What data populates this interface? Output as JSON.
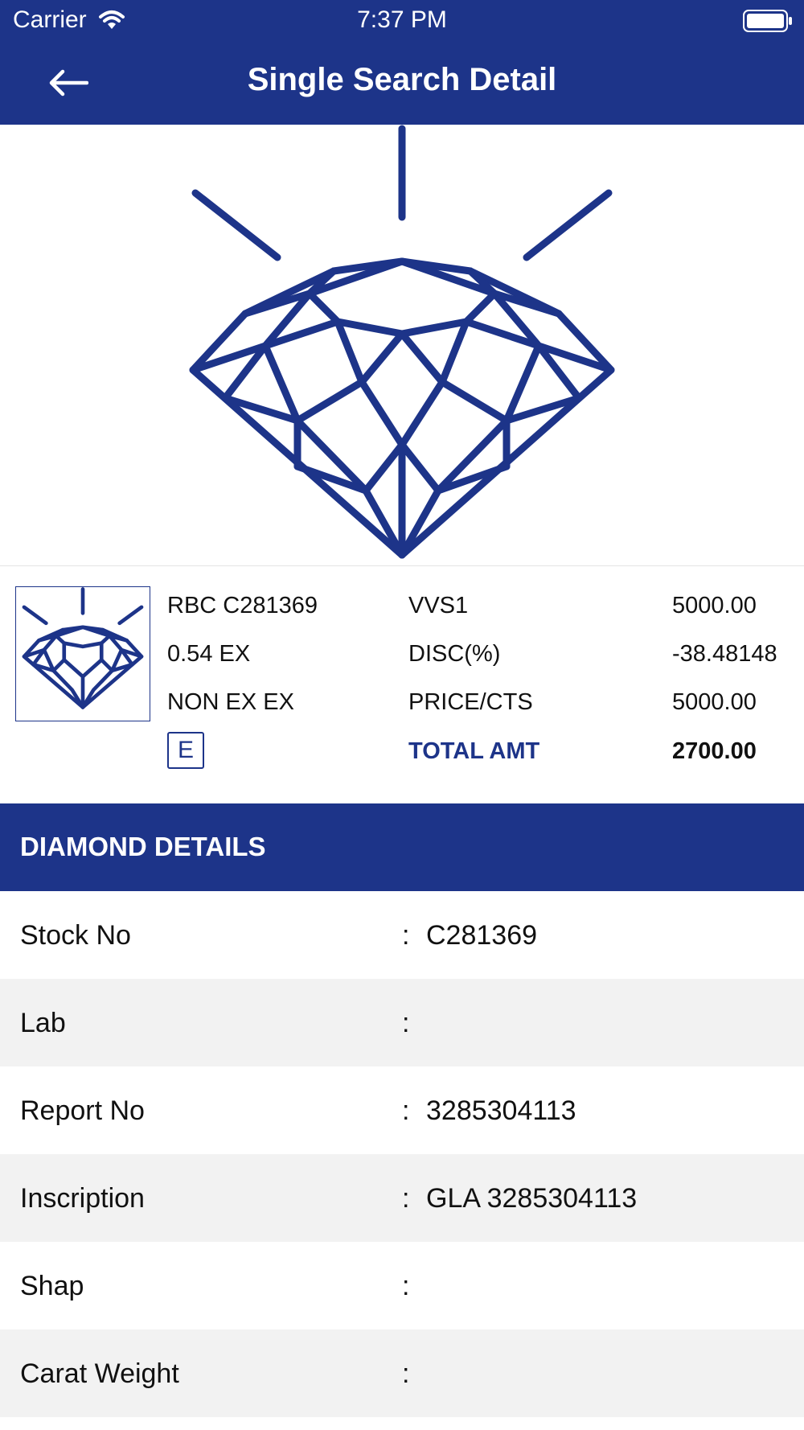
{
  "status_bar": {
    "carrier": "Carrier",
    "time": "7:37 PM"
  },
  "nav": {
    "title": "Single Search Detail"
  },
  "summary": {
    "col1": [
      "RBC C281369",
      "0.54 EX",
      "NON EX EX"
    ],
    "color_badge": "E",
    "col2": [
      "VVS1",
      "DISC(%)",
      "PRICE/CTS"
    ],
    "col3": [
      "5000.00",
      "-38.48148",
      "5000.00"
    ],
    "total_label": "TOTAL AMT",
    "total_value": "2700.00"
  },
  "section": {
    "title": "DIAMOND DETAILS"
  },
  "details": [
    {
      "label": "Stock No",
      "colon": ":",
      "value": "C281369"
    },
    {
      "label": "Lab",
      "colon": ":",
      "value": ""
    },
    {
      "label": "Report No",
      "colon": ":",
      "value": "3285304113"
    },
    {
      "label": "Inscription",
      "colon": ":",
      "value": "GLA 3285304113"
    },
    {
      "label": "Shap",
      "colon": ":",
      "value": ""
    },
    {
      "label": "Carat Weight",
      "colon": ":",
      "value": ""
    }
  ],
  "colors": {
    "brand": "#1d3489",
    "row_alt": "#f2f2f2"
  }
}
